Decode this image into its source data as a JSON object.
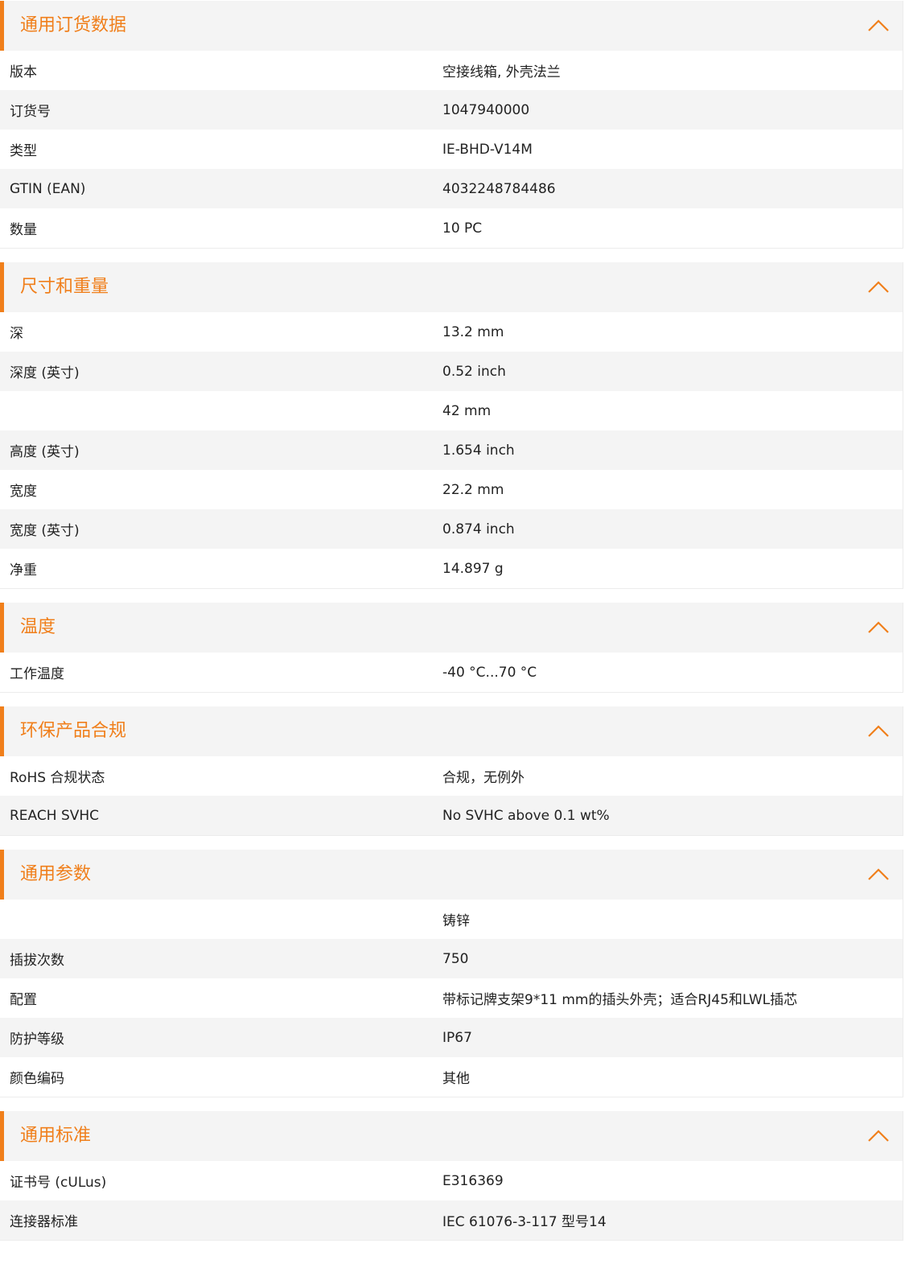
{
  "colors": {
    "accent": "#f07f1b",
    "header_bg": "#f4f4f4",
    "row_alt_bg": "#f4f4f4",
    "row_bg": "#ffffff",
    "text": "#222222"
  },
  "sections": [
    {
      "title": "通用订货数据",
      "icon": "chevron-up-icon",
      "rows": [
        {
          "label": "版本",
          "value": "空接线箱, 外壳法兰"
        },
        {
          "label": "订货号",
          "value": "1047940000"
        },
        {
          "label": "类型",
          "value": "IE-BHD-V14M"
        },
        {
          "label": "GTIN (EAN)",
          "value": "4032248784486"
        },
        {
          "label": "数量",
          "value": "10  PC"
        }
      ]
    },
    {
      "title": "尺寸和重量",
      "icon": "chevron-up-icon",
      "rows": [
        {
          "label": "深",
          "value": "13.2  mm"
        },
        {
          "label": "深度 (英寸)",
          "value": "0.52  inch"
        },
        {
          "label": "",
          "value": "42  mm"
        },
        {
          "label": "高度 (英寸)",
          "value": "1.654  inch"
        },
        {
          "label": "宽度",
          "value": "22.2  mm"
        },
        {
          "label": "宽度 (英寸)",
          "value": "0.874  inch"
        },
        {
          "label": "净重",
          "value": "14.897  g"
        }
      ]
    },
    {
      "title": "温度",
      "icon": "chevron-up-icon",
      "rows": [
        {
          "label": "工作温度",
          "value": "-40 °C...70 °C"
        }
      ]
    },
    {
      "title": "环保产品合规",
      "icon": "chevron-up-icon",
      "rows": [
        {
          "label": "RoHS 合规状态",
          "value": "合规，无例外"
        },
        {
          "label": "REACH SVHC",
          "value": "No SVHC above 0.1 wt%"
        }
      ]
    },
    {
      "title": "通用参数",
      "icon": "chevron-up-icon",
      "rows": [
        {
          "label": "",
          "value": "铸锌"
        },
        {
          "label": "插拔次数",
          "value": "750"
        },
        {
          "label": "配置",
          "value": "带标记牌支架9*11 mm的插头外壳；适合RJ45和LWL插芯"
        },
        {
          "label": "防护等级",
          "value": "IP67"
        },
        {
          "label": "颜色编码",
          "value": "其他"
        }
      ]
    },
    {
      "title": "通用标准",
      "icon": "chevron-up-icon",
      "rows": [
        {
          "label": "证书号 (cULus)",
          "value": "E316369"
        },
        {
          "label": "连接器标准",
          "value": "IEC 61076-3-117 型号14"
        }
      ]
    }
  ]
}
